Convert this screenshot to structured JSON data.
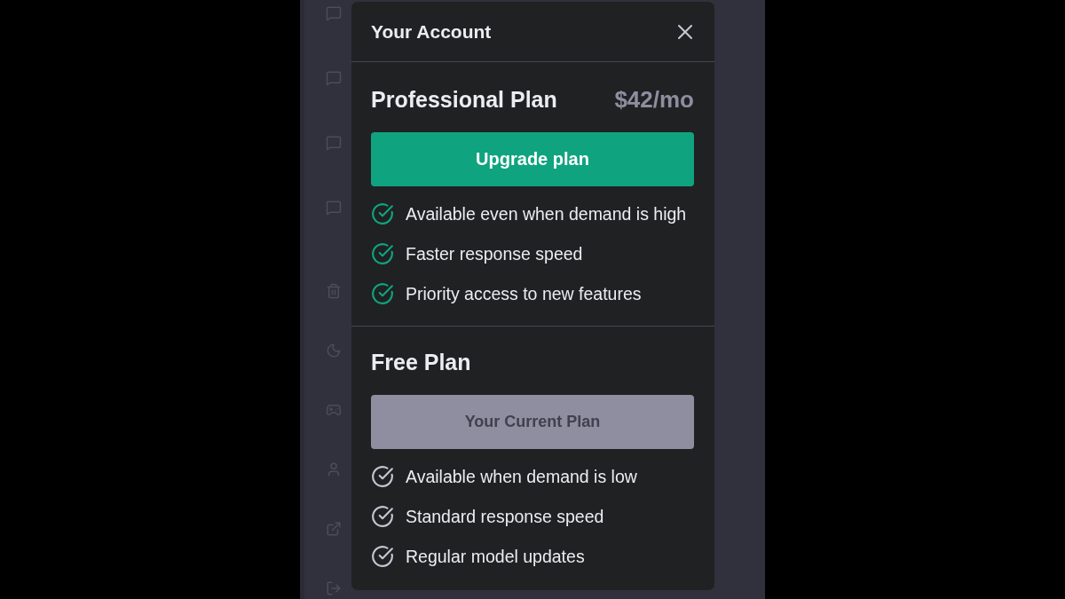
{
  "dialog": {
    "title": "Your Account"
  },
  "plans": [
    {
      "kind": "paid",
      "name": "Professional Plan",
      "price": "$42/mo",
      "button": {
        "label": "Upgrade plan",
        "disabled": false
      },
      "features": [
        "Available even when demand is high",
        "Faster response speed",
        "Priority access to new features"
      ]
    },
    {
      "kind": "free",
      "name": "Free Plan",
      "button": {
        "label": "Your Current Plan",
        "disabled": true
      },
      "features": [
        "Available when demand is low",
        "Standard response speed",
        "Regular model updates"
      ]
    }
  ]
}
